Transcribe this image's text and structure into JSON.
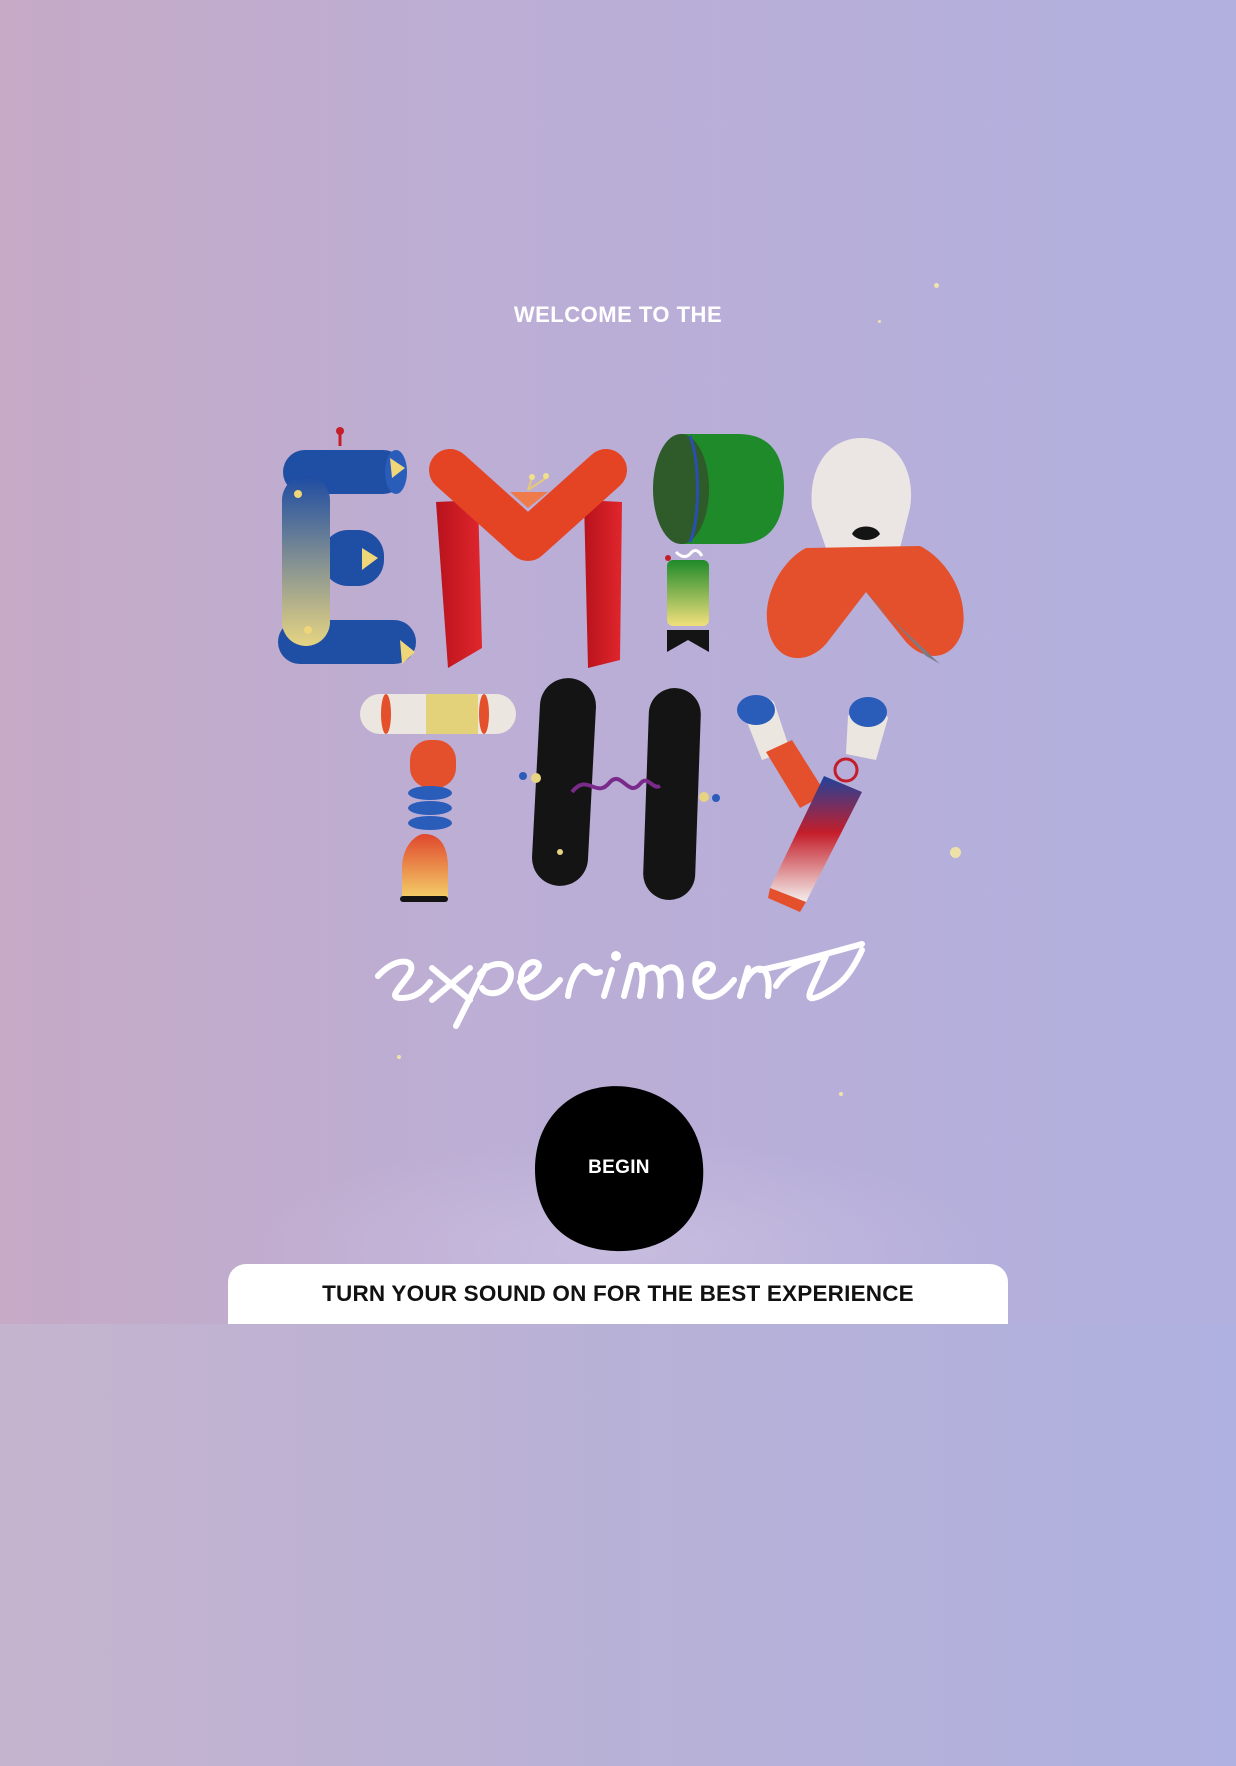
{
  "welcome": {
    "text": "WELCOME TO THE"
  },
  "title": {
    "word": "EMPATHY",
    "subtitle": "experiment"
  },
  "begin": {
    "label": "BEGIN"
  },
  "sound_notice": {
    "text": "TURN YOUR SOUND ON FOR THE BEST EXPERIENCE"
  },
  "colors": {
    "background_left": "#c6aac6",
    "background_right": "#b1b0df",
    "button": "#000000",
    "banner": "#ffffff",
    "letter_blue": "#1f4fa5",
    "letter_red": "#e24a28",
    "letter_green": "#1f7a1f",
    "letter_black": "#141414",
    "letter_yellow": "#e9d27a"
  }
}
